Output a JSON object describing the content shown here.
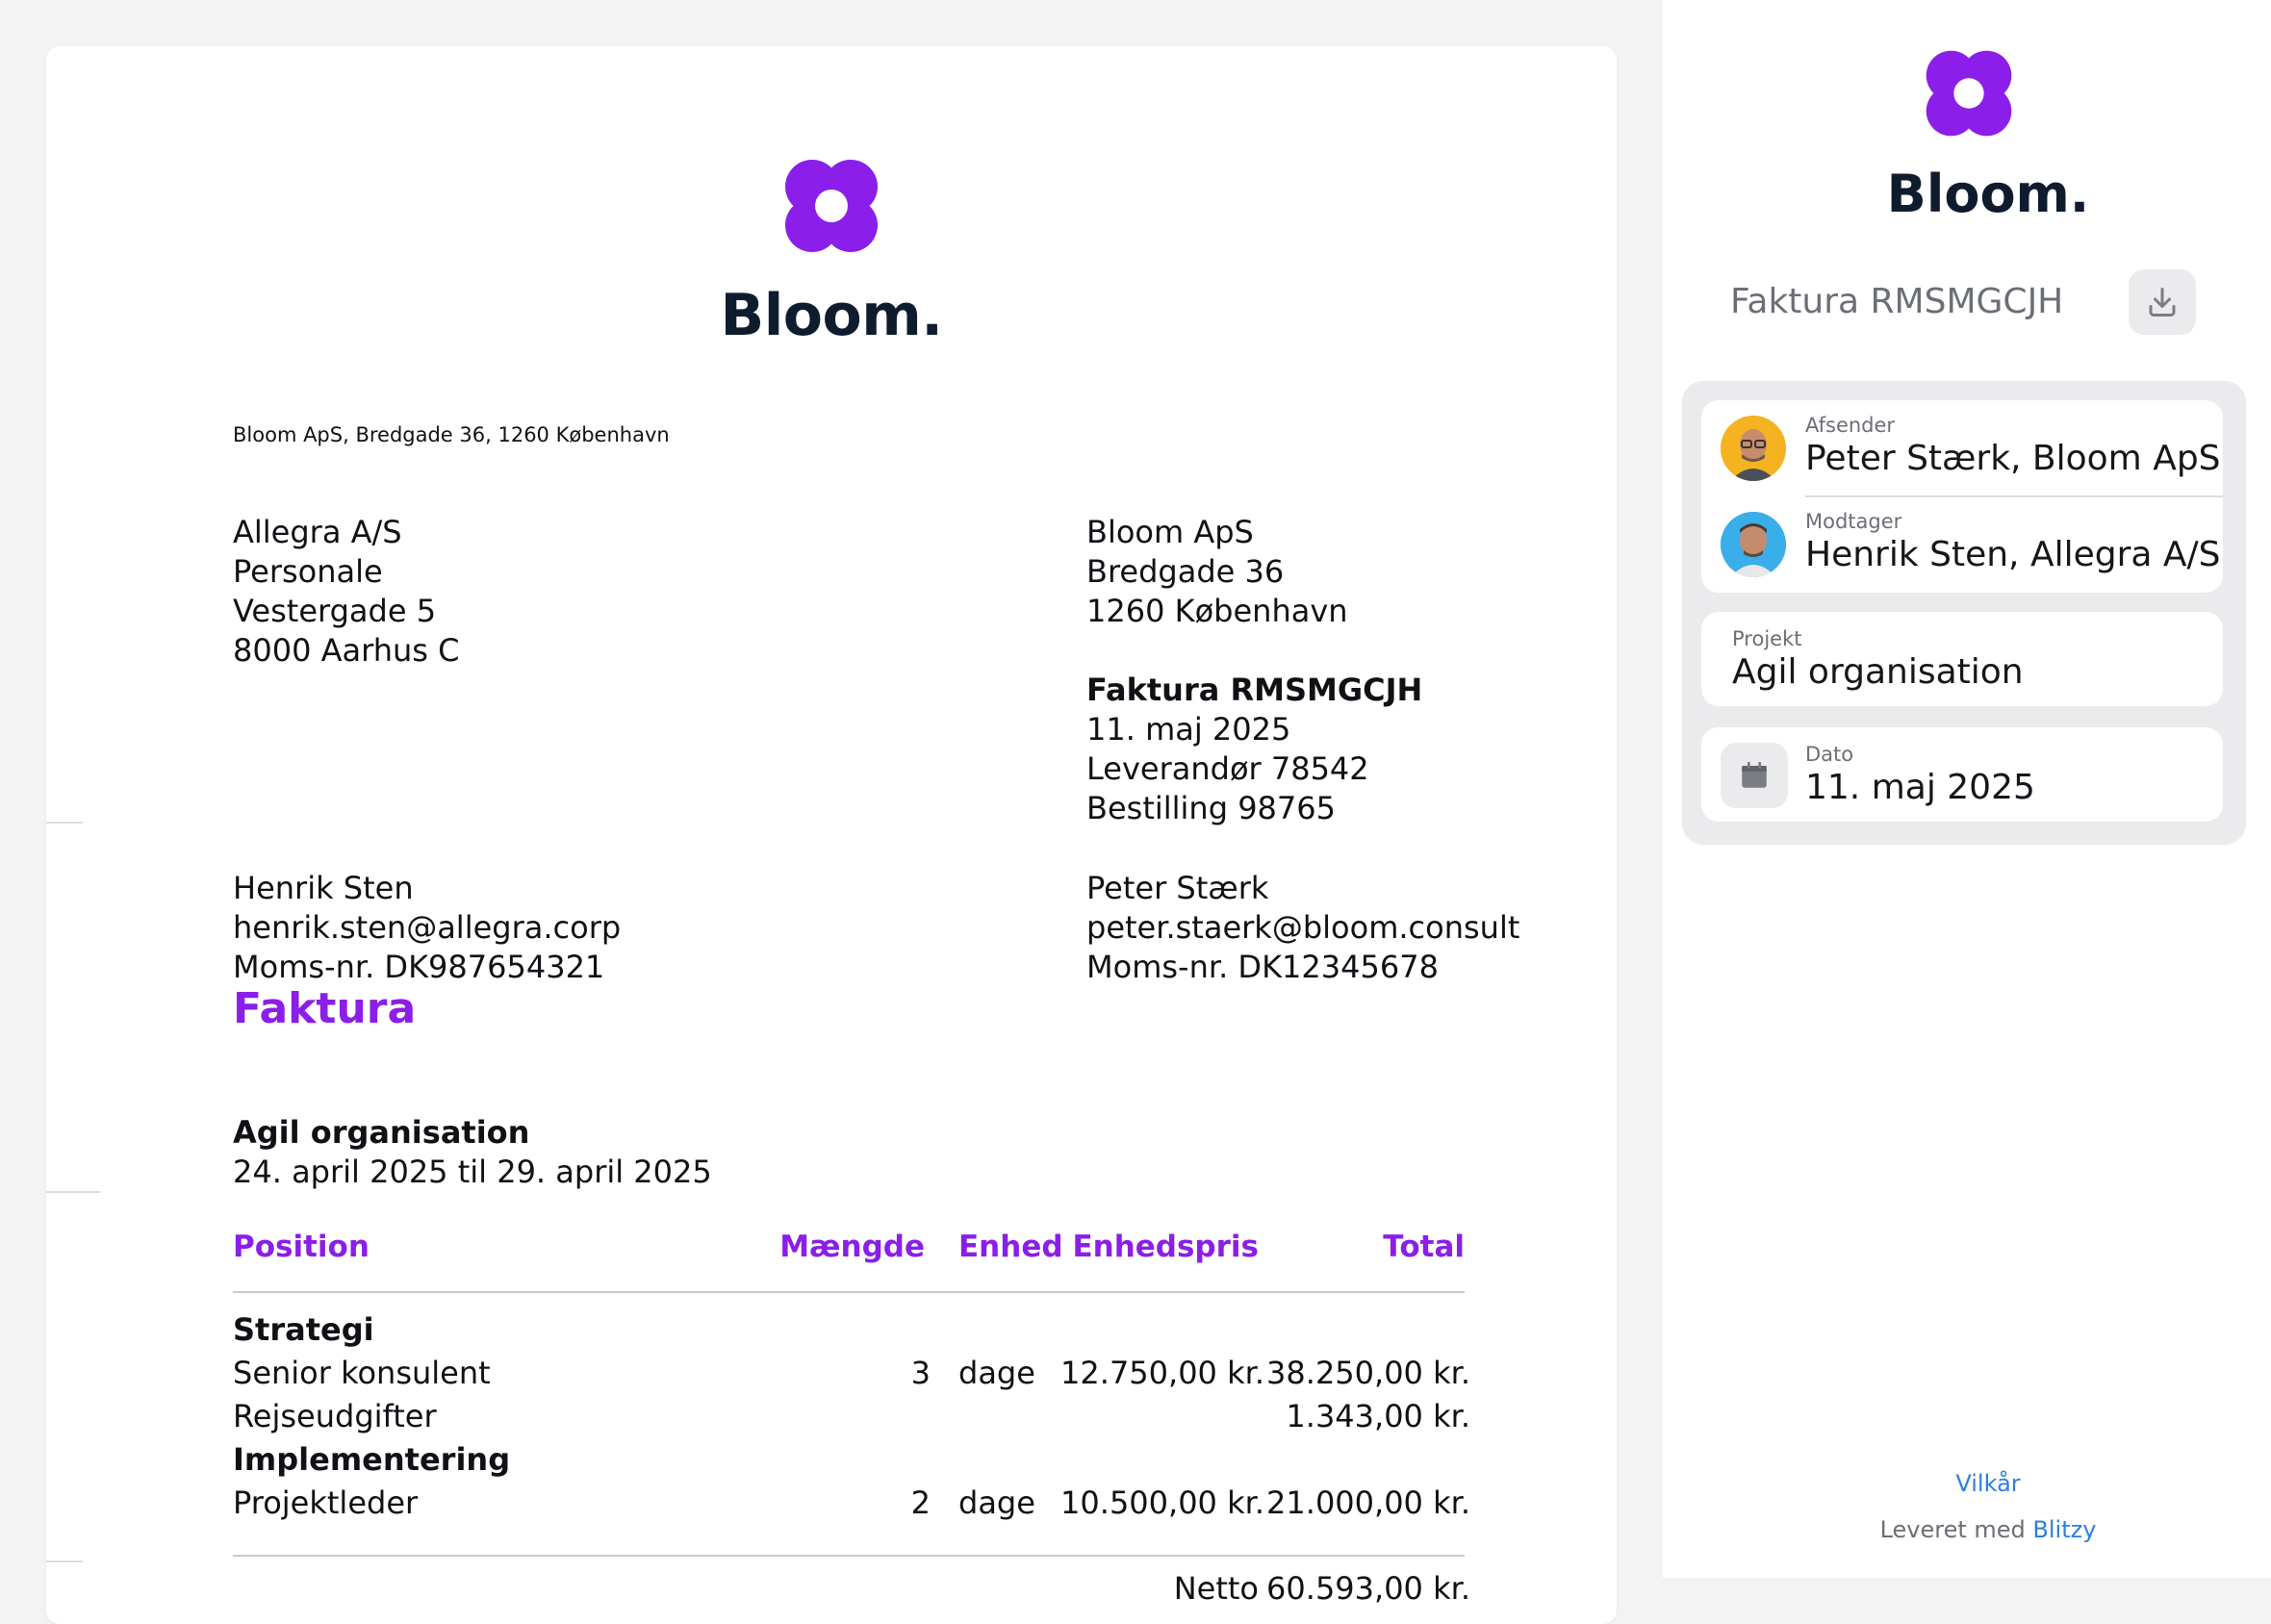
{
  "colors": {
    "accent": "#8b1ee8",
    "brand_dark": "#0f1c2e",
    "link": "#2d7ee0",
    "panel": "#ebebed"
  },
  "invoice": {
    "brand": "Bloom.",
    "sender_line": "Bloom ApS, Bredgade 36, 1260 København",
    "recipient_address": [
      "Allegra A/S",
      "Personale",
      "Vestergade 5",
      "8000 Aarhus C"
    ],
    "sender_address": [
      "Bloom ApS",
      "Bredgade 36",
      "1260 København"
    ],
    "invoice_title": "Faktura RMSMGCJH",
    "invoice_meta": [
      "11. maj 2025",
      "Leverandør 78542",
      "Bestilling 98765"
    ],
    "recipient_contact": [
      "Henrik Sten",
      "henrik.sten@allegra.corp",
      "Moms-nr. DK987654321"
    ],
    "sender_contact": [
      "Peter Stærk",
      "peter.staerk@bloom.consult",
      "Moms-nr. DK12345678"
    ],
    "heading": "Faktura",
    "project_name": "Agil organisation",
    "period": "24. april 2025 til 29. april 2025",
    "table": {
      "headers": {
        "position": "Position",
        "quantity": "Mængde",
        "unit": "Enhed",
        "unit_price": "Enhedspris",
        "total": "Total"
      },
      "rows": [
        {
          "position": "Strategi",
          "group": true
        },
        {
          "position": "Senior konsulent",
          "quantity": "3",
          "unit": "dage",
          "unit_price": "12.750,00 kr.",
          "total": "38.250,00 kr."
        },
        {
          "position": "Rejseudgifter",
          "quantity": "",
          "unit": "",
          "unit_price": "",
          "total": "1.343,00 kr."
        },
        {
          "position": "Implementering",
          "group": true
        },
        {
          "position": "Projektleder",
          "quantity": "2",
          "unit": "dage",
          "unit_price": "10.500,00 kr.",
          "total": "21.000,00 kr."
        }
      ],
      "net_label": "Netto",
      "net_value": "60.593,00 kr."
    }
  },
  "sidebar": {
    "brand": "Bloom.",
    "title": "Faktura RMSMGCJH",
    "download_icon": "download-icon",
    "sender_label": "Afsender",
    "sender_value": "Peter Stærk, Bloom ApS",
    "recipient_label": "Modtager",
    "recipient_value": "Henrik Sten, Allegra A/S",
    "project_label": "Projekt",
    "project_value": "Agil organisation",
    "date_label": "Dato",
    "date_value": "11. maj 2025",
    "calendar_icon": "calendar-icon",
    "terms_link": "Vilkår",
    "delivered_by": "Leveret med",
    "delivered_link": "Blitzy"
  }
}
